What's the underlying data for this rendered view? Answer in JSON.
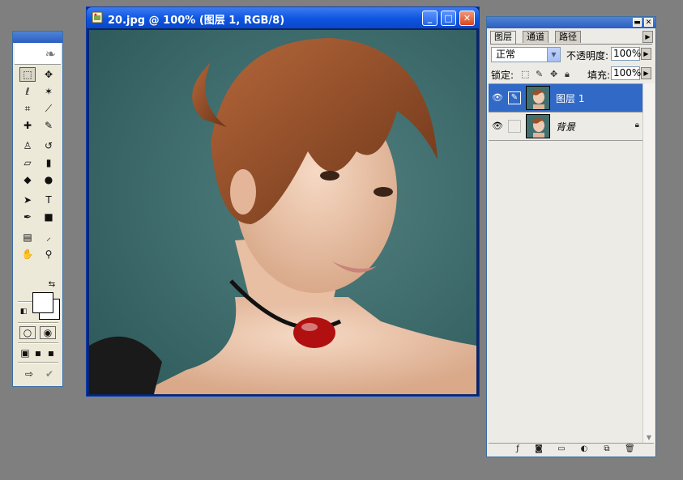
{
  "document": {
    "title": "20.jpg @ 100% (图层 1, RGB/8)",
    "buttons": {
      "minimize": "_",
      "maximize": "□",
      "close": "✕"
    }
  },
  "toolbox": {
    "tools": [
      "rect-marquee-icon",
      "move-icon",
      "lasso-icon",
      "magic-wand-icon",
      "crop-icon",
      "slice-icon",
      "healing-brush-icon",
      "brush-icon",
      "clone-stamp-icon",
      "history-brush-icon",
      "eraser-icon",
      "gradient-icon",
      "blur-icon",
      "dodge-icon",
      "path-select-icon",
      "type-icon",
      "pen-icon",
      "shape-icon",
      "notes-icon",
      "eyedropper-icon",
      "hand-icon",
      "zoom-icon"
    ],
    "glyphs": {
      "rect-marquee-icon": "⬚",
      "move-icon": "✥",
      "lasso-icon": "ℓ",
      "magic-wand-icon": "✶",
      "crop-icon": "⌗",
      "slice-icon": "⟋",
      "healing-brush-icon": "✚",
      "brush-icon": "✎",
      "clone-stamp-icon": "♙",
      "history-brush-icon": "↺",
      "eraser-icon": "▱",
      "gradient-icon": "▮",
      "blur-icon": "◆",
      "dodge-icon": "●",
      "path-select-icon": "➤",
      "type-icon": "T",
      "pen-icon": "✒",
      "shape-icon": "■",
      "notes-icon": "▤",
      "eyedropper-icon": "⸝",
      "hand-icon": "✋",
      "zoom-icon": "⚲"
    }
  },
  "layers_panel": {
    "tabs": [
      "图层",
      "通道",
      "路径"
    ],
    "blend_mode": "正常",
    "opacity_label": "不透明度:",
    "opacity_value": "100%",
    "lock_label": "锁定:",
    "fill_label": "填充:",
    "fill_value": "100%",
    "layers": [
      {
        "name": "图层 1",
        "selected": true,
        "locked": false
      },
      {
        "name": "背景",
        "selected": false,
        "locked": true
      }
    ]
  },
  "colors": {
    "accent": "#3169c6",
    "canvas_bg": "#3e6a6a",
    "workspace": "#7f7f7f"
  }
}
